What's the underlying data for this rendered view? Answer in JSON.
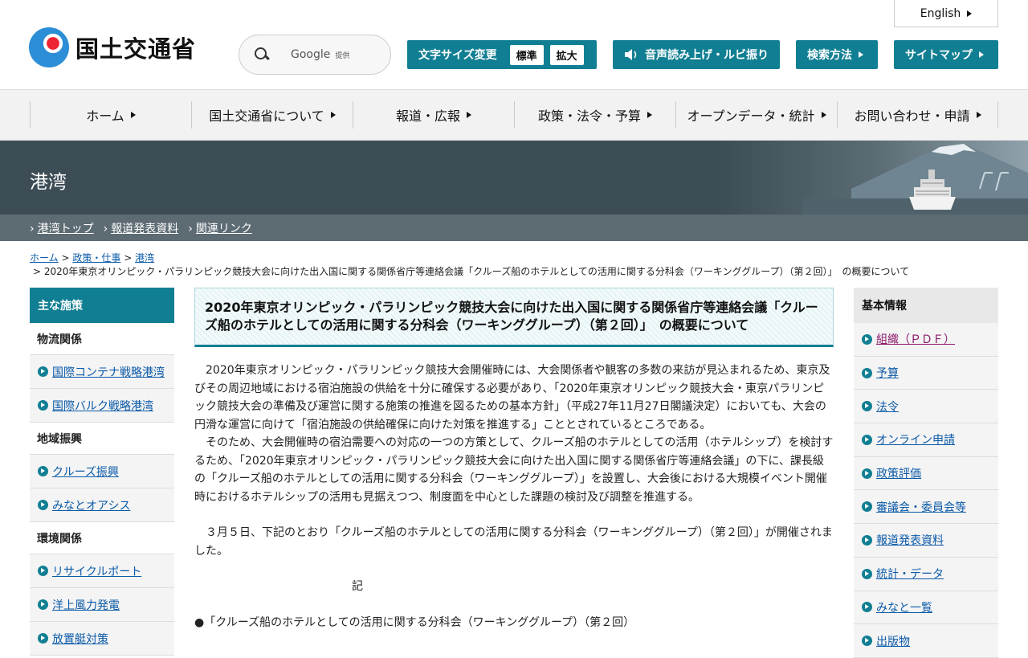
{
  "header": {
    "logo_text": "国土交通省",
    "search_google": "Google",
    "search_provided": "提供",
    "english": "English",
    "font_size_label": "文字サイズ変更",
    "font_standard": "標準",
    "font_large": "拡大",
    "speech": "音声読み上げ・ルビ振り",
    "search_method": "検索方法",
    "sitemap": "サイトマップ"
  },
  "gnav": [
    "ホーム",
    "国土交通省について",
    "報道・広報",
    "政策・法令・予算",
    "オープンデータ・統計",
    "お問い合わせ・申請"
  ],
  "banner": {
    "title": "港湾"
  },
  "subnav": [
    "港湾トップ",
    "報道発表資料",
    "関連リンク"
  ],
  "breadcrumb": {
    "home": "ホーム",
    "policy": "政策・仕事",
    "port": "港湾",
    "sep": ">",
    "current": "> 2020年東京オリンピック・パラリンピック競技大会に向けた出入国に関する関係省庁等連絡会議「クルーズ船のホテルとしての活用に関する分科会（ワーキンググループ）（第２回）」　の概要について"
  },
  "left": {
    "heading": "主な施策",
    "cat1": "物流関係",
    "link1": "国際コンテナ戦略港湾",
    "link2": "国際バルク戦略港湾",
    "cat2": "地域振興",
    "link3": "クルーズ振興",
    "link4": "みなとオアシス",
    "cat3": "環境関係",
    "link5": "リサイクルポート",
    "link6": "洋上風力発電",
    "link7": "放置艇対策"
  },
  "main": {
    "title": "2020年東京オリンピック・パラリンピック競技大会に向けた出入国に関する関係省庁等連絡会議「クルーズ船のホテルとしての活用に関する分科会（ワーキンググループ）（第２回）」　の概要について",
    "p1": "2020年東京オリンピック・パラリンピック競技大会開催時には、大会関係者や観客の多数の来訪が見込まれるため、東京及びその周辺地域における宿泊施設の供給を十分に確保する必要があり、「2020年東京オリンピック競技大会・東京パラリンピック競技大会の準備及び運営に関する施策の推進を図るための基本方針」（平成27年11月27日閣議決定）においても、大会の円滑な運営に向けて「宿泊施設の供給確保に向けた対策を推進する」こととされているところである。",
    "p2": "そのため、大会開催時の宿泊需要への対応の一つの方策として、クルーズ船のホテルとしての活用（ホテルシップ）を検討するため、「2020年東京オリンピック・パラリンピック競技大会に向けた出入国に関する関係省庁等連絡会議」の下に、課長級の「クルーズ船のホテルとしての活用に関する分科会（ワーキンググループ）」を設置し、大会後における大規模イベント開催時におけるホテルシップの活用も見据えつつ、制度面を中心とした課題の検討及び調整を推進する。",
    "p3": "３月５日、下記のとおり「クルーズ船のホテルとしての活用に関する分科会（ワーキンググループ）（第２回）」が開催されました。",
    "ki": "記",
    "bullet": "●「クルーズ船のホテルとしての活用に関する分科会（ワーキンググループ）（第２回）"
  },
  "right": {
    "heading": "基本情報",
    "links": [
      "組織（ＰＤＦ）",
      "予算",
      "法令",
      "オンライン申請",
      "政策評価",
      "審議会・委員会等",
      "報道発表資料",
      "統計・データ",
      "みなと一覧",
      "出版物"
    ]
  },
  "colors": {
    "accent": "#117f93",
    "link": "#0b5aa8",
    "banner": "#3d4d55"
  }
}
